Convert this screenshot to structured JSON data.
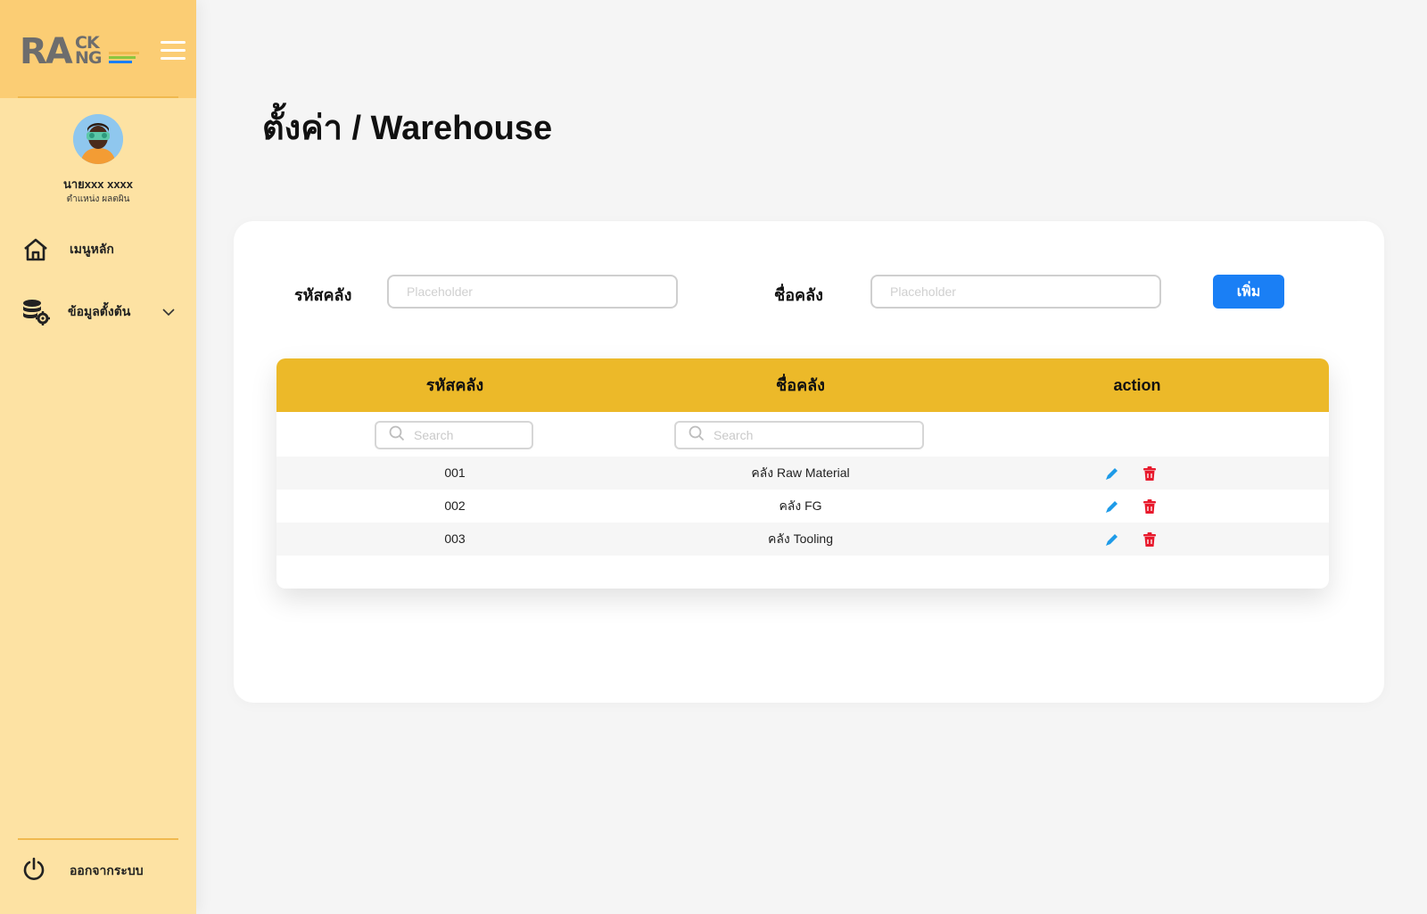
{
  "sidebar": {
    "logo": {
      "main": "RA",
      "top": "CK",
      "bottom": "NG",
      "colors": [
        "#f0b94f",
        "#8cc63f",
        "#1a7ff5"
      ]
    },
    "user": {
      "name": "นายxxx xxxx",
      "role": "ตำแหน่ง ผลตผิน"
    },
    "nav": [
      {
        "label": "เมนูหลัก",
        "icon": "home-icon"
      },
      {
        "label": "ข้อมูลตั้งต้น",
        "icon": "database-settings-icon"
      }
    ],
    "logout_label": "ออกจากระบบ"
  },
  "page": {
    "title": "ตั้งค่า / Warehouse"
  },
  "form": {
    "code_label": "รหัสคลัง",
    "code_placeholder": "Placeholder",
    "name_label": "ชื่อคลัง",
    "name_placeholder": "Placeholder",
    "add_label": "เพิ่ม"
  },
  "table": {
    "headers": [
      "รหัสคลัง",
      "ชื่อคลัง",
      "action"
    ],
    "search_placeholder": "Search",
    "rows": [
      {
        "code": "001",
        "name": "คลัง Raw Material"
      },
      {
        "code": "002",
        "name": "คลัง FG"
      },
      {
        "code": "003",
        "name": "คลัง Tooling"
      }
    ]
  },
  "colors": {
    "sidebar_bg": "#fde2a3",
    "sidebar_header": "#fbcd74",
    "table_header": "#ecb929",
    "primary_button": "#1a7ff5",
    "edit_icon": "#1e9be8",
    "delete_icon": "#e8192c"
  }
}
